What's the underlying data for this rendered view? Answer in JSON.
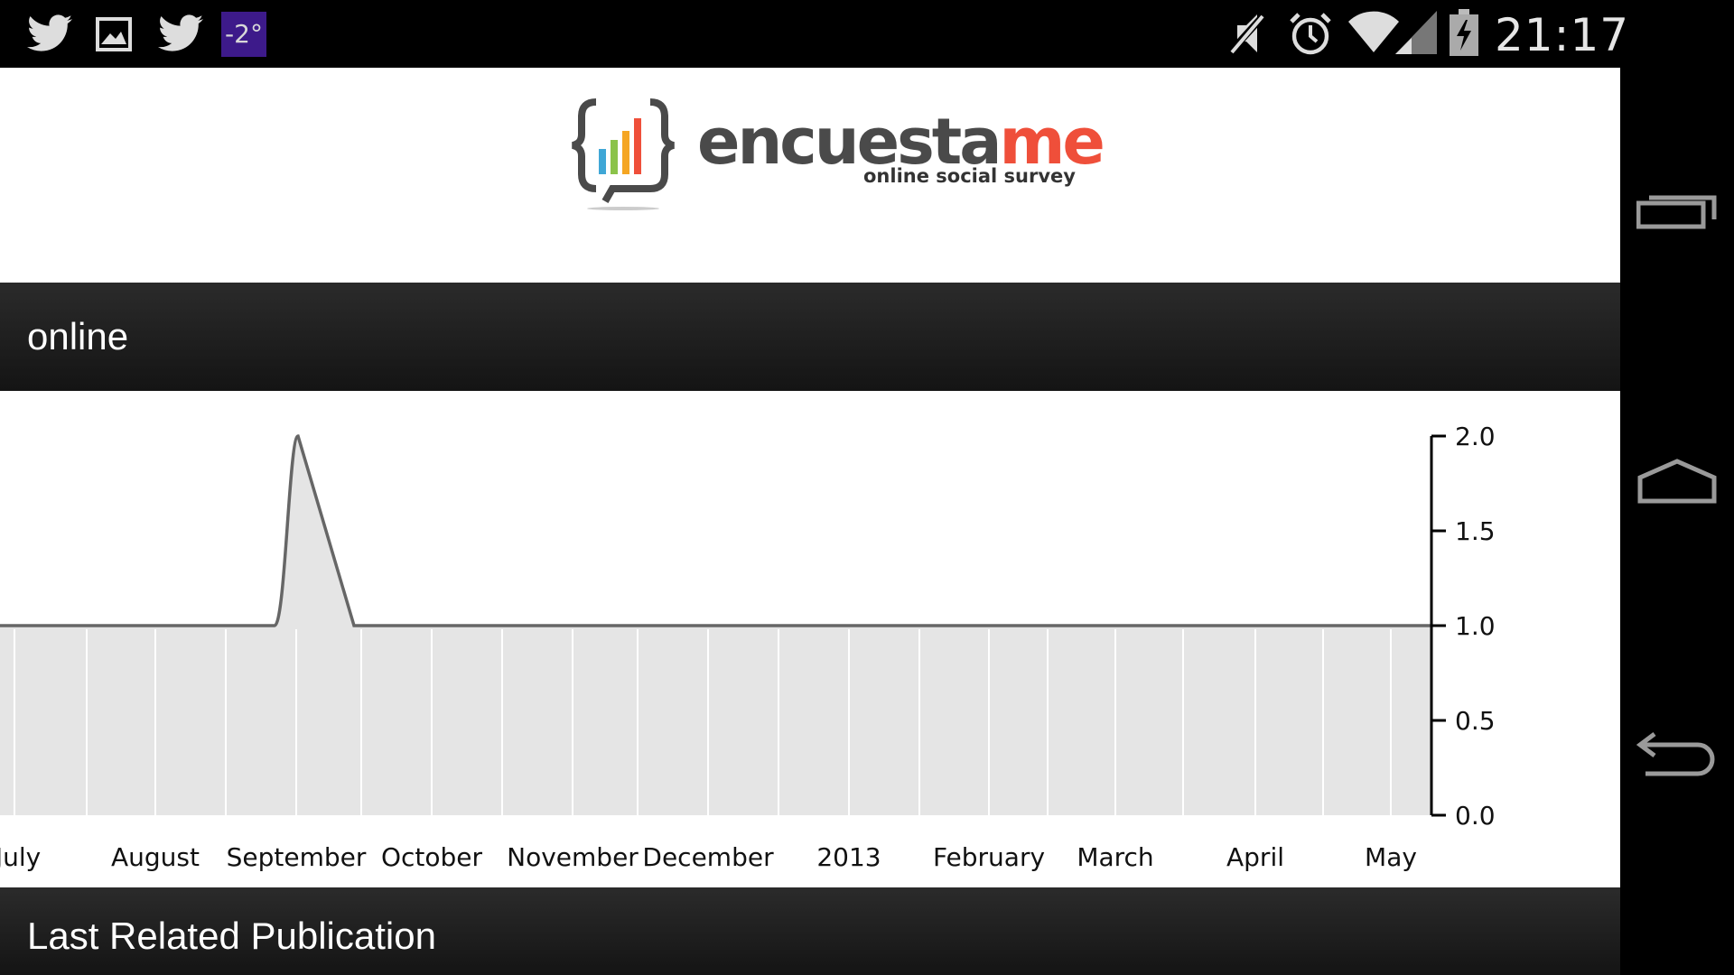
{
  "status_bar": {
    "time": "21:17",
    "temperature": "-2°",
    "left_icons": [
      "twitter-icon",
      "image-icon",
      "twitter-icon"
    ],
    "right_icons": [
      "mute-icon",
      "alarm-icon",
      "wifi-icon",
      "signal-icon",
      "battery-charging-icon"
    ]
  },
  "header": {
    "logo_name_main": "encuesta",
    "logo_name_accent": "me",
    "logo_tagline": "online social survey"
  },
  "section": {
    "title": "online"
  },
  "footer_section": {
    "title": "Last Related Publication"
  },
  "colors": {
    "band": "#1e1e1e",
    "plot_fill": "#e5e5e5",
    "line": "#666666",
    "logo_accent": "#ef4f3a",
    "temp_badge": "#3d1a8a"
  },
  "chart_data": {
    "type": "area",
    "x_ticks": [
      "July",
      "August",
      "September",
      "October",
      "November",
      "December",
      "2013",
      "February",
      "March",
      "April",
      "May"
    ],
    "y_ticks": [
      "0.0",
      "0.5",
      "1.0",
      "1.5",
      "2.0"
    ],
    "ylim": [
      0,
      2
    ],
    "y_axis_side": "right",
    "grid": true,
    "points": [
      {
        "x": "July",
        "y": 1
      },
      {
        "x": "early September",
        "y": 1
      },
      {
        "x": "September",
        "y": 2
      },
      {
        "x": "late September",
        "y": 1
      },
      {
        "x": "May",
        "y": 1
      }
    ]
  },
  "nav": [
    "recent-apps-icon",
    "home-icon",
    "back-icon"
  ]
}
